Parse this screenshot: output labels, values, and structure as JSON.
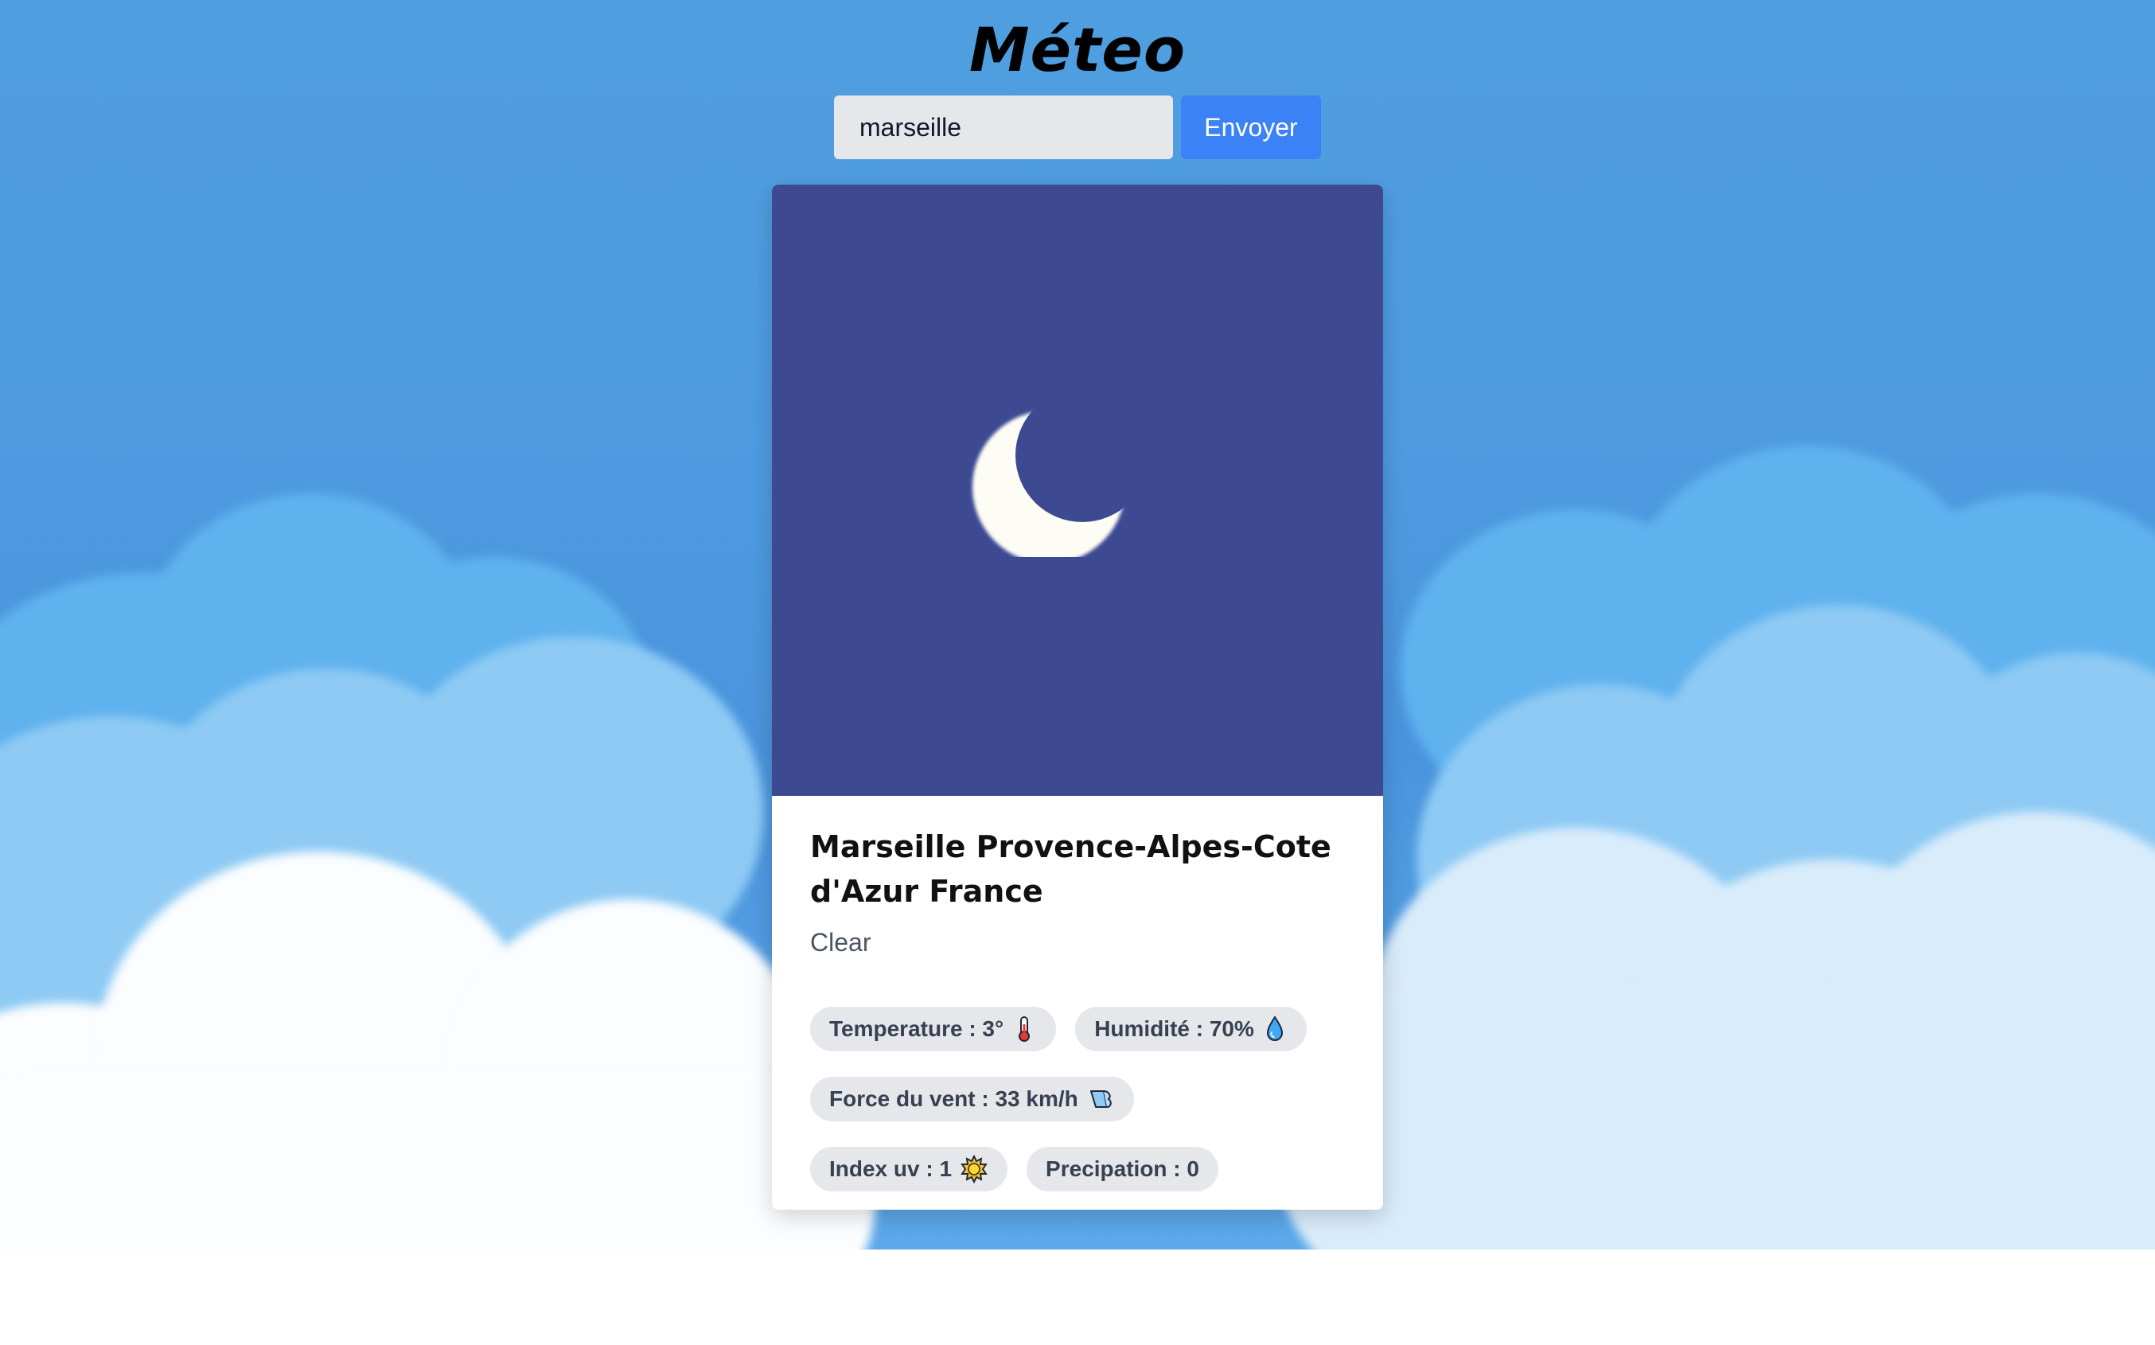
{
  "app": {
    "title": "Méteo"
  },
  "search": {
    "value": "marseille",
    "button_label": "Envoyer"
  },
  "weather_card": {
    "image_icon": "moon-icon",
    "location": "Marseille Provence-Alpes-Cote d'Azur France",
    "condition": "Clear",
    "stats": [
      {
        "label": "Temperature : 3°",
        "icon": "thermometer-icon"
      },
      {
        "label": "Humidité : 70%",
        "icon": "droplet-icon"
      },
      {
        "label": "Force du vent : 33 km/h",
        "icon": "wind-icon"
      },
      {
        "label": "Index uv : 1",
        "icon": "sun-icon"
      },
      {
        "label": "Precipation : 0",
        "icon": ""
      }
    ]
  },
  "colors": {
    "sky": "#4f9ee0",
    "button": "#3b82f6",
    "image_background": "#3d4a92",
    "chip_background": "#e5e7eb"
  }
}
